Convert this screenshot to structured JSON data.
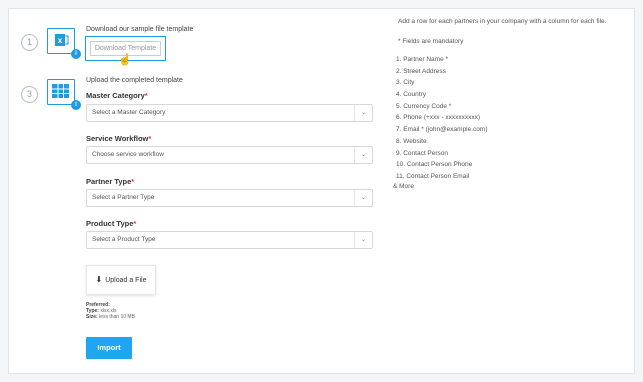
{
  "step1": {
    "number": "1",
    "badge_icon": "cloud-download-icon",
    "file_icon": "excel-file-icon",
    "caption": "Download our sample file template",
    "button_label": "Download Template"
  },
  "step2": {
    "number": "3",
    "badge_icon": "cloud-upload-icon",
    "file_icon": "spreadsheet-table-icon",
    "caption": "Upload the completed template"
  },
  "form": {
    "master_category": {
      "label": "Master Category",
      "required": "*",
      "placeholder": "Select a Master Category"
    },
    "service_workflow": {
      "label": "Service Workflow",
      "required": "*",
      "placeholder": "Choose service workflow"
    },
    "partner_type": {
      "label": "Partner Type",
      "required": "*",
      "placeholder": "Select a Partner Type"
    },
    "product_type": {
      "label": "Product Type",
      "required": "*",
      "placeholder": "Select a Product Type"
    },
    "upload_label": "Upload a File",
    "preferred_label": "Preferred:",
    "type_label": "Type:",
    "type_value": "xlsx,xls",
    "size_label": "Size:",
    "size_value": "less than 10 MB",
    "import_label": "Import"
  },
  "instructions": {
    "intro": "Add a row for each partners in your company with a column for each file.",
    "mandatory_note": "* Fields are mandatory",
    "fields": [
      "1. Partner Name *",
      "2. Street Address",
      "3. City",
      "4. Country",
      "5. Currency Code *",
      "6. Phone (+xxx - xxxxxxxxxx)",
      "7. Email * (john@example.com)",
      "8. Website",
      "9. Contact Person",
      "10. Contact Person Phone",
      "11. Contact Person Email"
    ],
    "more": "& More"
  },
  "colors": {
    "accent": "#1ea7f0",
    "required": "#e0363c"
  }
}
